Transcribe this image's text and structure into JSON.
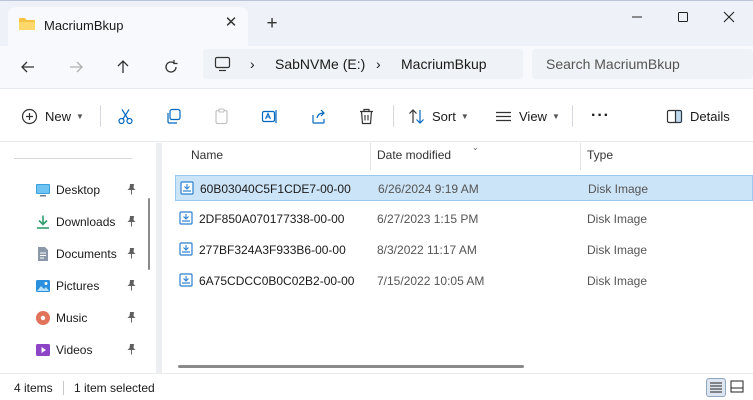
{
  "window": {
    "tab_title": "MacriumBkup",
    "new_tab_symbol": "+",
    "tab_close_symbol": "✕"
  },
  "address_bar": {
    "breadcrumbs": [
      "SabNVMe (E:)",
      "MacriumBkup"
    ],
    "separator": "›",
    "search_placeholder": "Search MacriumBkup"
  },
  "commands": {
    "new_label": "New",
    "sort_label": "Sort",
    "view_label": "View",
    "more_label": "···",
    "details_label": "Details"
  },
  "nav_pane": {
    "items": [
      {
        "label": "Desktop",
        "icon": "desktop-icon"
      },
      {
        "label": "Downloads",
        "icon": "downloads-icon"
      },
      {
        "label": "Documents",
        "icon": "documents-icon"
      },
      {
        "label": "Pictures",
        "icon": "pictures-icon"
      },
      {
        "label": "Music",
        "icon": "music-icon"
      },
      {
        "label": "Videos",
        "icon": "videos-icon"
      }
    ]
  },
  "file_list": {
    "columns": {
      "name": "Name",
      "date": "Date modified",
      "type": "Type"
    },
    "rows": [
      {
        "name": "60B03040C5F1CDE7-00-00",
        "date": "6/26/2024 9:19 AM",
        "type": "Disk Image",
        "selected": true
      },
      {
        "name": "2DF850A070177338-00-00",
        "date": "6/27/2023 1:15 PM",
        "type": "Disk Image",
        "selected": false
      },
      {
        "name": "277BF324A3F933B6-00-00",
        "date": "8/3/2022 11:17 AM",
        "type": "Disk Image",
        "selected": false
      },
      {
        "name": "6A75CDCC0B0C02B2-00-00",
        "date": "7/15/2022 10:05 AM",
        "type": "Disk Image",
        "selected": false
      }
    ]
  },
  "status_bar": {
    "item_count": "4 items",
    "selection": "1 item selected"
  },
  "colors": {
    "accent": "#0067c0",
    "selection_bg": "#cce4f7",
    "selection_border": "#99c9ef",
    "folder": "#f5c244"
  }
}
